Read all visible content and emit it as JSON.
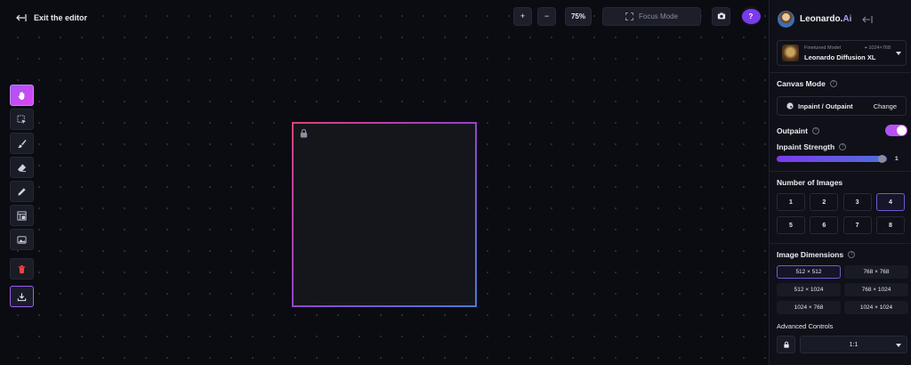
{
  "editor": {
    "exit_label": "Exit the editor"
  },
  "topbar": {
    "zoom_in": "+",
    "zoom_out": "−",
    "zoom_level": "75%",
    "focus_mode": "Focus Mode",
    "help": "?"
  },
  "tools": [
    {
      "name": "pan-tool",
      "icon": "hand-icon",
      "active": true
    },
    {
      "name": "select-tool",
      "icon": "select-icon"
    },
    {
      "name": "brush-tool",
      "icon": "brush-icon"
    },
    {
      "name": "eraser-tool",
      "icon": "eraser-icon"
    },
    {
      "name": "pencil-tool",
      "icon": "pencil-icon"
    },
    {
      "name": "frame-tool",
      "icon": "frame-icon"
    },
    {
      "name": "image-tool",
      "icon": "image-icon"
    },
    {
      "name": "delete-tool",
      "icon": "trash-icon"
    },
    {
      "name": "download-tool",
      "icon": "download-icon"
    }
  ],
  "brand": {
    "name": "Leonardo.",
    "suffix": "Ai"
  },
  "model": {
    "label": "Finetuned Model",
    "dimensions": "1024×768",
    "name": "Leonardo Diffusion XL"
  },
  "canvas_mode": {
    "title": "Canvas Mode",
    "mode": "Inpaint / Outpaint",
    "change": "Change"
  },
  "outpaint": {
    "label": "Outpaint",
    "enabled": true
  },
  "inpaint_strength": {
    "label": "Inpaint Strength",
    "value": "1",
    "fraction": 1.0
  },
  "num_images": {
    "title": "Number of Images",
    "options": [
      "1",
      "2",
      "3",
      "4",
      "5",
      "6",
      "7",
      "8"
    ],
    "selected": "4"
  },
  "image_dimensions": {
    "title": "Image Dimensions",
    "options": [
      "512 × 512",
      "768 × 768",
      "512 × 1024",
      "768 × 1024",
      "1024 × 768",
      "1024 × 1024"
    ],
    "selected": "512 × 512"
  },
  "advanced": {
    "label": "Advanced Controls",
    "ratio": "1:1"
  },
  "colors": {
    "accent": "#a855f7",
    "accent2": "#d946ef",
    "danger": "#ef4444"
  }
}
